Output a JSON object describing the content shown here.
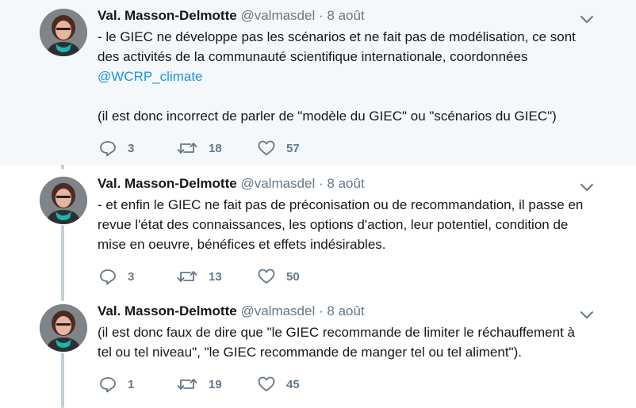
{
  "tweets": [
    {
      "author_name": "Val. Masson-Delmotte",
      "handle": "@valmasdel",
      "separator": "·",
      "date": "8 août",
      "text_line1": "- le GIEC ne développe pas les scénarios et ne fait pas de modélisation, ce sont",
      "text_line2": "des activités de la communauté scientifique internationale, coordonnées",
      "mention": "@WCRP_climate",
      "text_line4": "(il est donc incorrect de parler de \"modèle du GIEC\" ou \"scénarios du GIEC\")",
      "replies": "3",
      "retweets": "18",
      "likes": "57"
    },
    {
      "author_name": "Val. Masson-Delmotte",
      "handle": "@valmasdel",
      "separator": "·",
      "date": "8 août",
      "text_line1": "- et enfin le GIEC ne fait pas de préconisation ou de recommandation, il passe en",
      "text_line2": "revue l'état des connaissances, les options d'action, leur potentiel, condition de",
      "text_line3": "mise en oeuvre, bénéfices et effets indésirables.",
      "replies": "3",
      "retweets": "13",
      "likes": "50"
    },
    {
      "author_name": "Val. Masson-Delmotte",
      "handle": "@valmasdel",
      "separator": "·",
      "date": "8 août",
      "text_line1": "(il est donc faux de dire que \"le GIEC recommande de limiter le réchauffement à",
      "text_line2": "tel ou tel niveau\", \"le GIEC recommande de manger tel ou tel aliment\").",
      "replies": "1",
      "retweets": "19",
      "likes": "45"
    }
  ],
  "icons": {
    "reply": "reply-icon",
    "retweet": "retweet-icon",
    "like": "heart-icon",
    "more": "chevron-down-icon"
  },
  "colors": {
    "highlight_bg": "#f5f8fa",
    "mention": "#1b95e0",
    "thread_line": "#c4cfd6",
    "muted": "#657786"
  }
}
